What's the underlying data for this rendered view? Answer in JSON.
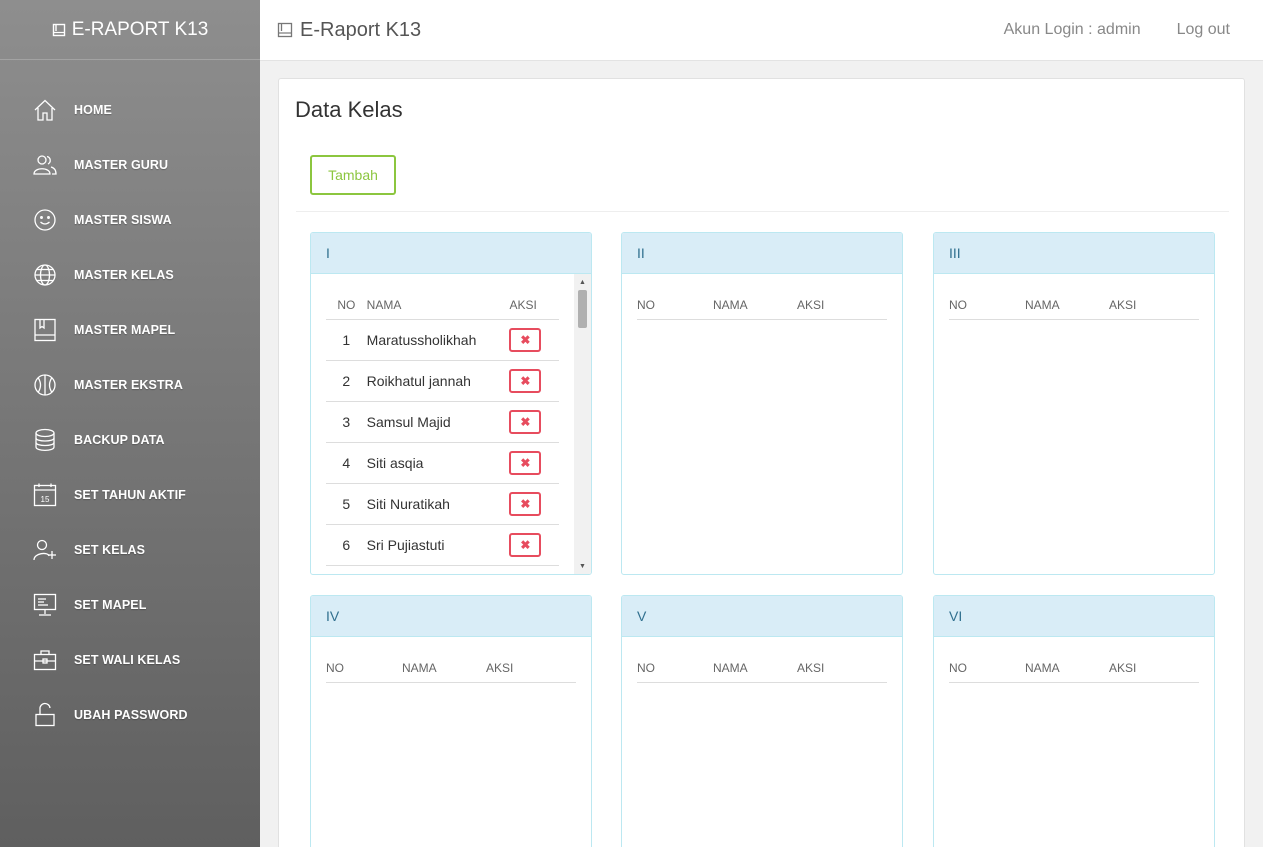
{
  "sidebar": {
    "brand": "E-RAPORT K13",
    "items": [
      {
        "label": "HOME",
        "icon": "home-icon"
      },
      {
        "label": "MASTER GURU",
        "icon": "users-icon"
      },
      {
        "label": "MASTER SISWA",
        "icon": "smile-icon"
      },
      {
        "label": "MASTER KELAS",
        "icon": "globe-icon"
      },
      {
        "label": "MASTER MAPEL",
        "icon": "book-icon"
      },
      {
        "label": "MASTER EKSTRA",
        "icon": "basketball-icon"
      },
      {
        "label": "BACKUP DATA",
        "icon": "database-icon"
      },
      {
        "label": "SET TAHUN AKTIF",
        "icon": "calendar-icon",
        "badge": "15"
      },
      {
        "label": "SET KELAS",
        "icon": "user-add-icon"
      },
      {
        "label": "SET MAPEL",
        "icon": "presentation-icon"
      },
      {
        "label": "SET WALI KELAS",
        "icon": "briefcase-icon"
      },
      {
        "label": "UBAH PASSWORD",
        "icon": "unlock-icon"
      }
    ]
  },
  "topbar": {
    "title": "E-Raport K13",
    "account": "Akun Login : admin",
    "logout": "Log out"
  },
  "main": {
    "heading": "Data Kelas",
    "add_label": "Tambah",
    "table_headers": {
      "no": "NO",
      "nama": "NAMA",
      "aksi": "AKSI"
    },
    "delete_symbol": "✖",
    "panels": [
      {
        "title": "I",
        "rows": [
          {
            "no": "1",
            "nama": "Maratussholikhah"
          },
          {
            "no": "2",
            "nama": "Roikhatul jannah"
          },
          {
            "no": "3",
            "nama": "Samsul Majid"
          },
          {
            "no": "4",
            "nama": "Siti asqia"
          },
          {
            "no": "5",
            "nama": "Siti Nuratikah"
          },
          {
            "no": "6",
            "nama": "Sri Pujiastuti"
          }
        ]
      },
      {
        "title": "II",
        "rows": []
      },
      {
        "title": "III",
        "rows": []
      },
      {
        "title": "IV",
        "rows": []
      },
      {
        "title": "V",
        "rows": []
      },
      {
        "title": "VI",
        "rows": []
      }
    ]
  },
  "colors": {
    "accent_green": "#8cc63f",
    "danger_red": "#e74c5e",
    "panel_head_bg": "#d9edf7",
    "panel_head_text": "#31708f"
  }
}
